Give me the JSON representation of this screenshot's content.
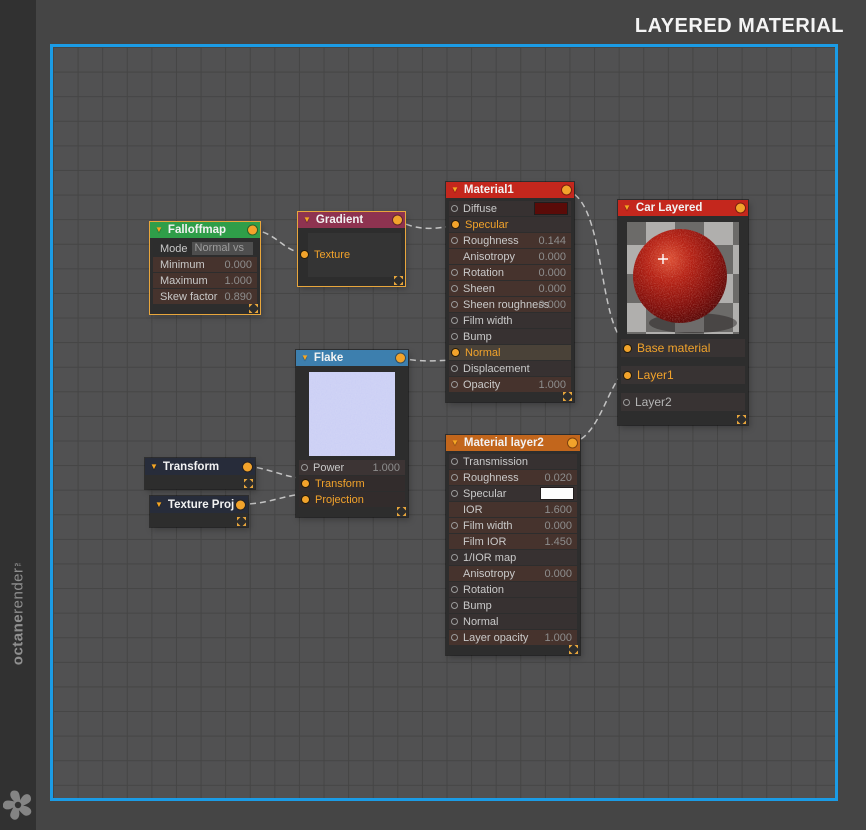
{
  "header": {
    "title": "LAYERED MATERIAL"
  },
  "brand": {
    "name_bold": "octane",
    "name_light": "render",
    "trademark": "™"
  },
  "colors": {
    "canvas_frame": "#1b9ce6",
    "selection_border": "#e8a63c",
    "wire": "#c3c3c3",
    "pin_orange": "#f2a32b",
    "diffuse_swatch": "#5a0b08",
    "specular_swatch": "#fdfdfd"
  },
  "nodes": {
    "falloffmap": {
      "title": "Falloffmap",
      "header_color": "#2f9e49",
      "rows": [
        {
          "label": "Mode",
          "value": "Normal vs"
        },
        {
          "label": "Minimum",
          "value": "0.000"
        },
        {
          "label": "Maximum",
          "value": "1.000"
        },
        {
          "label": "Skew factor",
          "value": "0.890"
        }
      ]
    },
    "gradient": {
      "title": "Gradient",
      "header_color": "#8e3350",
      "rows": [
        {
          "label": "Texture"
        }
      ]
    },
    "material1": {
      "title": "Material1",
      "header_color": "#c4271d",
      "rows": [
        {
          "label": "Diffuse"
        },
        {
          "label": "Specular"
        },
        {
          "label": "Roughness",
          "value": "0.144"
        },
        {
          "label": "Anisotropy",
          "value": "0.000"
        },
        {
          "label": "Rotation",
          "value": "0.000"
        },
        {
          "label": "Sheen",
          "value": "0.000"
        },
        {
          "label": "Sheen roughness",
          "value": "0.000"
        },
        {
          "label": "Film width"
        },
        {
          "label": "Bump"
        },
        {
          "label": "Normal"
        },
        {
          "label": "Displacement"
        },
        {
          "label": "Opacity",
          "value": "1.000"
        }
      ]
    },
    "flake": {
      "title": "Flake",
      "header_color": "#3d7fae",
      "rows": [
        {
          "label": "Power",
          "value": "1.000"
        },
        {
          "label": "Transform"
        },
        {
          "label": "Projection"
        }
      ]
    },
    "transform": {
      "title": "Transform",
      "header_color": "#272c3a",
      "rows": []
    },
    "texture_proj": {
      "title": "Texture Proj",
      "header_color": "#272c3a",
      "rows": []
    },
    "car_layered": {
      "title": "Car Layered",
      "header_color": "#c4271d",
      "rows": [
        {
          "label": "Base material"
        },
        {
          "label": "Layer1"
        },
        {
          "label": "Layer2"
        }
      ]
    },
    "material_layer2": {
      "title": "Material layer2",
      "header_color": "#c2661c",
      "rows": [
        {
          "label": "Transmission"
        },
        {
          "label": "Roughness",
          "value": "0.020"
        },
        {
          "label": "Specular"
        },
        {
          "label": "IOR",
          "value": "1.600"
        },
        {
          "label": "Film width",
          "value": "0.000"
        },
        {
          "label": "Film IOR",
          "value": "1.450"
        },
        {
          "label": "1/IOR map"
        },
        {
          "label": "Anisotropy",
          "value": "0.000"
        },
        {
          "label": "Rotation"
        },
        {
          "label": "Bump"
        },
        {
          "label": "Normal"
        },
        {
          "label": "Layer opacity",
          "value": "1.000"
        }
      ]
    }
  }
}
